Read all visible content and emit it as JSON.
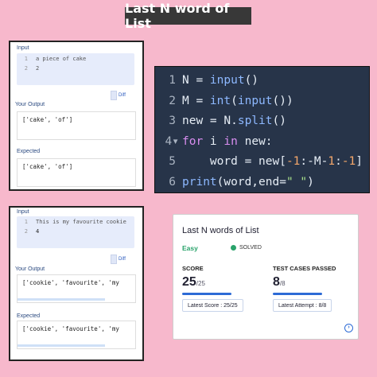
{
  "title": "Last N word of List",
  "panel1": {
    "input_label": "Input",
    "lines": [
      {
        "num": "1",
        "text": "a piece of cake"
      },
      {
        "num": "2",
        "text": "2"
      }
    ],
    "diff_label": "Diff",
    "output_label": "Your Output",
    "output_value": "['cake', 'of']",
    "expected_label": "Expected",
    "expected_value": "['cake', 'of']"
  },
  "panel2": {
    "input_label": "Input",
    "lines": [
      {
        "num": "1",
        "text": "This is my favourite cookie"
      },
      {
        "num": "2",
        "text": "4"
      }
    ],
    "diff_label": "Diff",
    "output_label": "Your Output",
    "output_value": "['cookie', 'favourite', 'my",
    "expected_label": "Expected",
    "expected_value": "['cookie', 'favourite', 'my"
  },
  "code": {
    "lines": [
      {
        "num": "1",
        "fold": false,
        "tokens": [
          [
            "pl",
            "N = "
          ],
          [
            "fn",
            "input"
          ],
          [
            "pl",
            "()"
          ]
        ]
      },
      {
        "num": "2",
        "fold": false,
        "tokens": [
          [
            "pl",
            "M = "
          ],
          [
            "fn",
            "int"
          ],
          [
            "pl",
            "("
          ],
          [
            "fn",
            "input"
          ],
          [
            "pl",
            "())"
          ]
        ]
      },
      {
        "num": "3",
        "fold": false,
        "tokens": [
          [
            "pl",
            "new = N."
          ],
          [
            "fn",
            "split"
          ],
          [
            "pl",
            "()"
          ]
        ]
      },
      {
        "num": "4",
        "fold": true,
        "tokens": [
          [
            "kw",
            "for"
          ],
          [
            "pl",
            " i "
          ],
          [
            "kw",
            "in"
          ],
          [
            "pl",
            " new:"
          ]
        ]
      },
      {
        "num": "5",
        "fold": false,
        "tokens": [
          [
            "pl",
            "    word = new["
          ],
          [
            "num",
            "-1"
          ],
          [
            "pl",
            ":-M-"
          ],
          [
            "num",
            "1"
          ],
          [
            "pl",
            ":"
          ],
          [
            "num",
            "-1"
          ],
          [
            "pl",
            "]"
          ]
        ]
      },
      {
        "num": "6",
        "fold": false,
        "tokens": [
          [
            "fn",
            "print"
          ],
          [
            "pl",
            "(word,end="
          ],
          [
            "str",
            "\" \""
          ],
          [
            "pl",
            ")"
          ]
        ]
      }
    ],
    "fold_marker": "▾"
  },
  "card": {
    "title": "Last N words of List",
    "difficulty": "Easy",
    "status": "SOLVED",
    "score_label": "SCORE",
    "score_value": "25",
    "score_total": "/25",
    "tests_label": "TEST CASES PASSED",
    "tests_value": "8",
    "tests_total": "/8",
    "latest_score": "Latest Score : 25/25",
    "latest_attempt": "Latest Attempt : 8/8",
    "score_progress": 1.0,
    "tests_progress": 1.0
  },
  "colors": {
    "background": "#f7b8cc",
    "code_bg": "#273449",
    "accent": "#2d6bd6",
    "success": "#2aa36b"
  }
}
